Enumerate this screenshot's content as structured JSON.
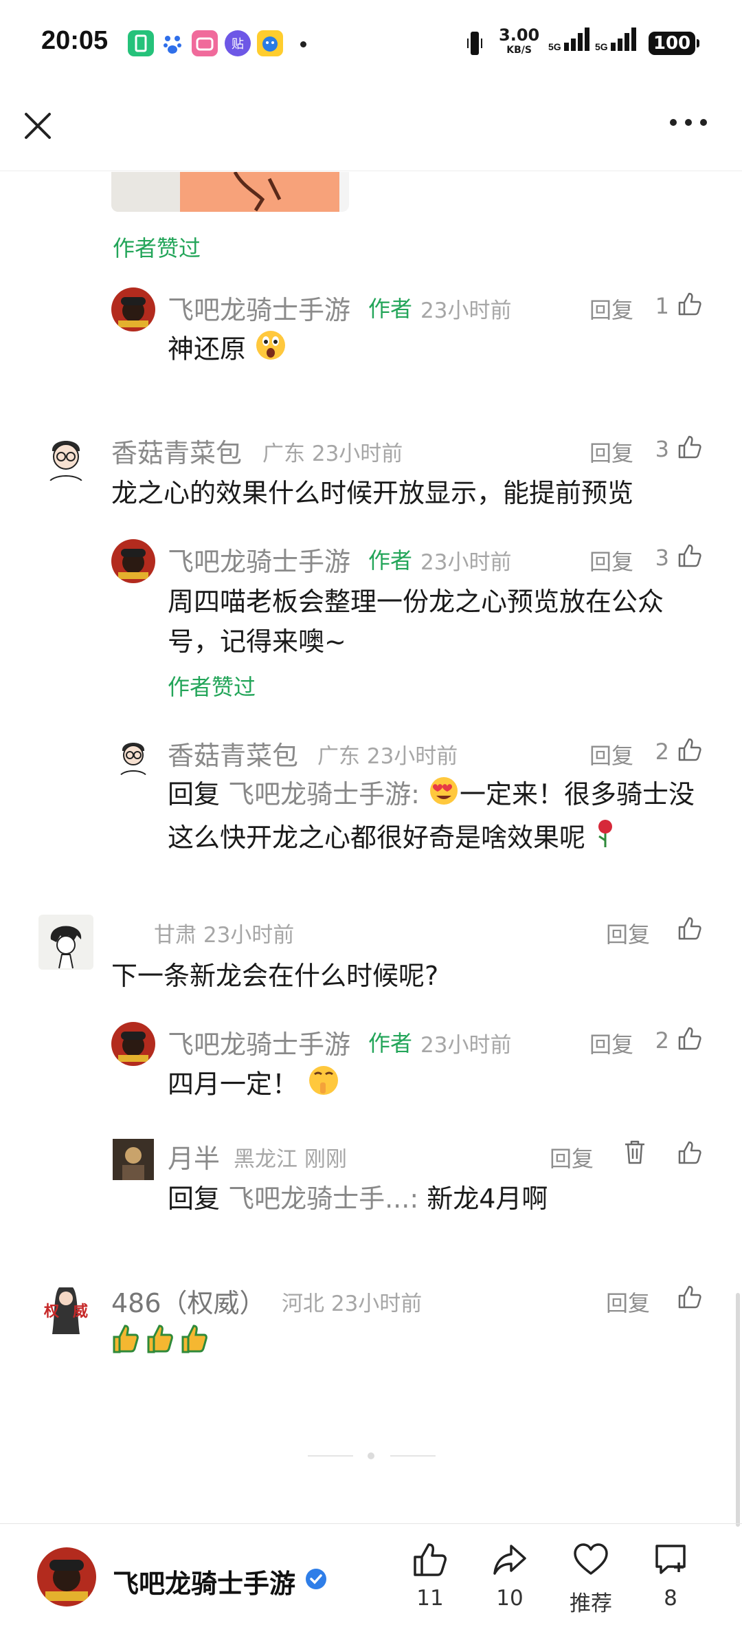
{
  "status_bar": {
    "time": "20:05",
    "speed_value": "3.00",
    "speed_unit": "KB/S",
    "network1": "5G",
    "network2": "5G",
    "battery": "100"
  },
  "nav": {
    "close_icon": "close-icon",
    "more_icon": "more-icon"
  },
  "thread": {
    "image_caption_text": "",
    "top_author_liked": "作者赞过",
    "reply_1": {
      "name": "飞吧龙骑士手游",
      "tag": "作者",
      "meta": "23小时前",
      "reply": "回复",
      "likes": "1",
      "text": "神还原"
    },
    "c2": {
      "name": "香菇青菜包",
      "meta": "广东 23小时前",
      "reply": "回复",
      "likes": "3",
      "text": "龙之心的效果什么时候开放显示，能提前预览"
    },
    "c2_r1": {
      "name": "飞吧龙骑士手游",
      "tag": "作者",
      "meta": "23小时前",
      "reply": "回复",
      "likes": "3",
      "text": "周四喵老板会整理一份龙之心预览放在公众号，记得来噢~",
      "liked": "作者赞过"
    },
    "c2_r2": {
      "name": "香菇青菜包",
      "meta": "广东 23小时前",
      "reply": "回复",
      "likes": "2",
      "prefix": "回复 ",
      "target": "飞吧龙骑士手游:",
      "text": "一定来！很多骑士没这么快开龙之心都很好奇是啥效果呢"
    },
    "c3": {
      "name": "",
      "meta": "甘肃 23小时前",
      "reply": "回复",
      "text": "下一条新龙会在什么时候呢?"
    },
    "c3_r1": {
      "name": "飞吧龙骑士手游",
      "tag": "作者",
      "meta": "23小时前",
      "reply": "回复",
      "likes": "2",
      "text": "四月一定！"
    },
    "c3_r2": {
      "name": "月半",
      "meta": "黑龙江  刚刚",
      "reply": "回复",
      "prefix": "回复 ",
      "target": "飞吧龙骑士手...:",
      "text": " 新龙4月啊"
    },
    "c4": {
      "name": "486（权威）",
      "meta": "河北 23小时前",
      "reply": "回复"
    }
  },
  "bottom_bar": {
    "account_name": "飞吧龙骑士手游",
    "like_count": "11",
    "share_count": "10",
    "recommend_label": "推荐",
    "comment_count": "8"
  }
}
